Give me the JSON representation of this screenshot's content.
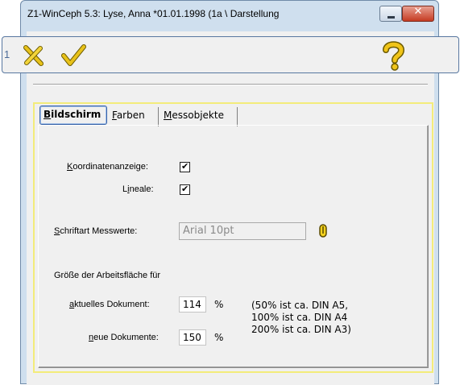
{
  "window": {
    "title": "Z1-WinCeph 5.3: Lyse, Anna *01.01.1998 (1a \\ Darstellung"
  },
  "toolbar": {
    "marker": "1",
    "cancel_icon": "cancel-x-icon",
    "ok_icon": "checkmark-icon",
    "help_icon": "help-question-icon"
  },
  "tabs": [
    {
      "accel": "B",
      "rest": "ildschirm",
      "active": true
    },
    {
      "accel": "F",
      "rest": "arben",
      "active": false
    },
    {
      "accel": "M",
      "rest": "essobjekte",
      "active": false
    }
  ],
  "bildschirm": {
    "koordinaten_accel": "K",
    "koordinaten_rest": "oordinatenanzeige:",
    "koordinaten_checked": true,
    "lineale_pre": "L",
    "lineale_accel": "i",
    "lineale_rest": "neale:",
    "lineale_checked": true,
    "schrift_accel": "S",
    "schrift_rest": "chriftart Messwerte:",
    "schrift_value": "Arial 10pt",
    "groesse_heading": "Größe der Arbeitsfläche für",
    "aktuell_accel": "a",
    "aktuell_rest": "ktuelles Dokument:",
    "aktuell_value": "114",
    "neue_accel": "n",
    "neue_rest": "eue Dokumente:",
    "neue_value": "150",
    "percent": "%",
    "hint_line1": "(50% ist ca. DIN A5,",
    "hint_line2": "100% ist ca. DIN A4",
    "hint_line3": "200% ist ca. DIN A3)"
  },
  "colors": {
    "panel_border": "#f3ec7a",
    "accent_blue": "#3a64a8",
    "titlebar": "#cfdfee",
    "close_red": "#c53b22"
  }
}
